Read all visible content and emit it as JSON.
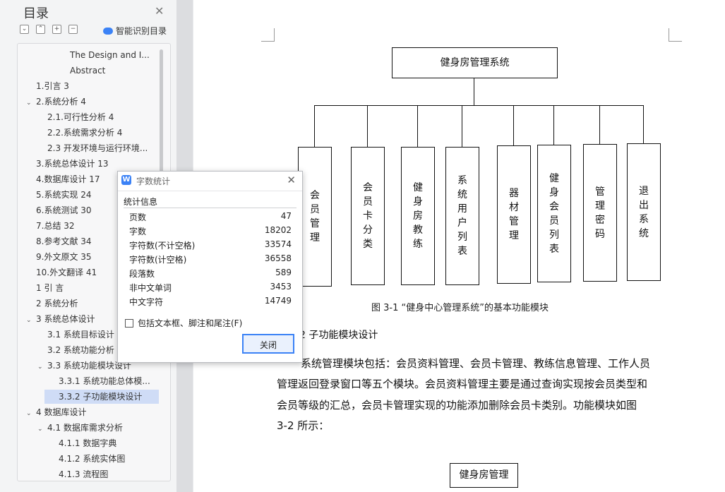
{
  "sidebar": {
    "title": "目录",
    "tool_buttons": [
      "⌄",
      "⌃",
      "+",
      "−"
    ],
    "ai_toc_label": "智能识别目录",
    "toc": [
      {
        "text": "The Design and I...",
        "level": 3,
        "arrow": ""
      },
      {
        "text": "Abstract",
        "level": 3,
        "arrow": ""
      },
      {
        "text": "1.引言 3",
        "level": 1,
        "arrow": ""
      },
      {
        "text": "2.系统分析 4",
        "level": 1,
        "arrow": "⌄"
      },
      {
        "text": "2.1.可行性分析 4",
        "level": 2,
        "arrow": ""
      },
      {
        "text": "2.2.系统需求分析 4",
        "level": 2,
        "arrow": ""
      },
      {
        "text": "2.3 开发环境与运行环境...",
        "level": 2,
        "arrow": ""
      },
      {
        "text": "3.系统总体设计 13",
        "level": 1,
        "arrow": ""
      },
      {
        "text": "4.数据库设计 17",
        "level": 1,
        "arrow": ""
      },
      {
        "text": "5.系统实现 24",
        "level": 1,
        "arrow": ""
      },
      {
        "text": "6.系统测试 30",
        "level": 1,
        "arrow": ""
      },
      {
        "text": "7.总结 32",
        "level": 1,
        "arrow": ""
      },
      {
        "text": "8.参考文献 34",
        "level": 1,
        "arrow": ""
      },
      {
        "text": "9.外文原文 35",
        "level": 1,
        "arrow": ""
      },
      {
        "text": "10.外文翻译 41",
        "level": 1,
        "arrow": ""
      },
      {
        "text": "1 引 言",
        "level": 1,
        "arrow": ""
      },
      {
        "text": "2 系统分析",
        "level": 1,
        "arrow": ""
      },
      {
        "text": "3 系统总体设计",
        "level": 1,
        "arrow": "⌄"
      },
      {
        "text": "3.1 系统目标设计",
        "level": 2,
        "arrow": ""
      },
      {
        "text": "3.2 系统功能分析",
        "level": 2,
        "arrow": ""
      },
      {
        "text": "3.3 系统功能模块设计",
        "level": 2,
        "arrow": "⌄"
      },
      {
        "text": "3.3.1 系统功能总体模...",
        "level": 3,
        "arrow": ""
      },
      {
        "text": "3.3.2 子功能模块设计",
        "level": 3,
        "arrow": "",
        "selected": true
      },
      {
        "text": "4 数据库设计",
        "level": 1,
        "arrow": "⌄"
      },
      {
        "text": "4.1 数据库需求分析",
        "level": 2,
        "arrow": "⌄"
      },
      {
        "text": "4.1.1 数据字典",
        "level": 3,
        "arrow": ""
      },
      {
        "text": "4.1.2 系统实体图",
        "level": 3,
        "arrow": ""
      },
      {
        "text": "4.1.3 流程图",
        "level": 3,
        "arrow": ""
      }
    ]
  },
  "document": {
    "root_box": "健身房管理系统",
    "modules": [
      "会员管理",
      "会员卡分类",
      "健身房教练",
      "系统用户列表",
      "器材管理",
      "健身会员列表",
      "管理密码",
      "退出系统"
    ],
    "caption": "图 3-1   “健身中心管理系统”的基本功能模块",
    "heading": "2 子功能模块设计",
    "paragraph_lines": [
      "系统管理模块包括：会员资料管理、会员卡管理、教练信息管理、工作人员",
      "管理返回登录窗口等五个模块。会员资料管理主要是通过查询实现按会员类型和",
      "会员等级的汇总，会员卡管理实现的功能添加删除会员卡类别。功能模块如图",
      "3-2 所示："
    ],
    "bottom_box": "健身房管理"
  },
  "dialog": {
    "title": "字数统计",
    "section": "统计信息",
    "stats": [
      {
        "label": "页数",
        "value": "47"
      },
      {
        "label": "字数",
        "value": "18202"
      },
      {
        "label": "字符数(不计空格)",
        "value": "33574"
      },
      {
        "label": "字符数(计空格)",
        "value": "36558"
      },
      {
        "label": "段落数",
        "value": "589"
      },
      {
        "label": "非中文单词",
        "value": "3453"
      },
      {
        "label": "中文字符",
        "value": "14749"
      }
    ],
    "checkbox_label": "包括文本框、脚注和尾注(F)",
    "close_button": "关闭"
  }
}
